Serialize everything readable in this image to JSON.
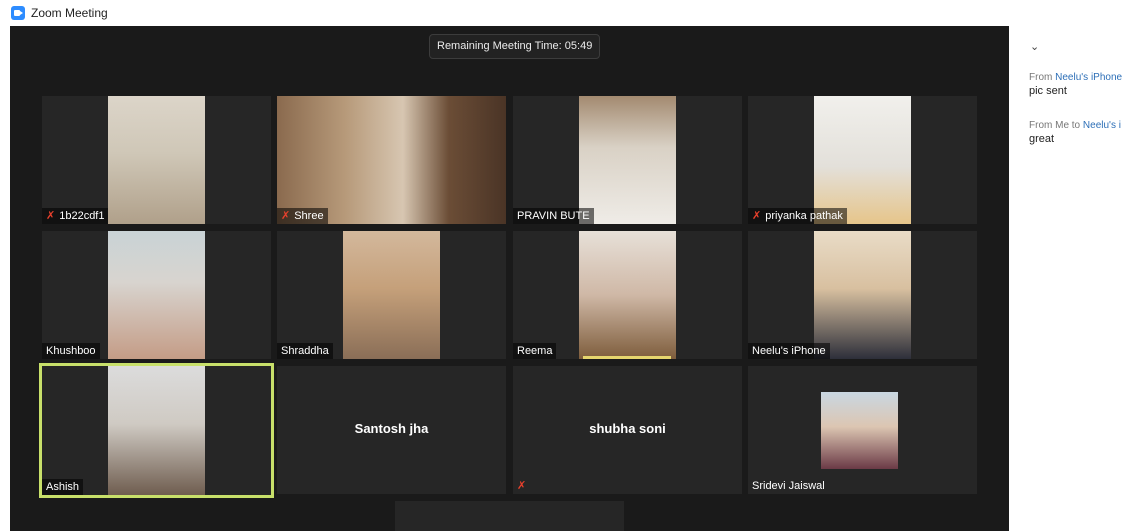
{
  "window": {
    "title": "Zoom Meeting"
  },
  "meeting": {
    "remaining_time": "Remaining Meeting Time: 05:49"
  },
  "participants": [
    {
      "name": "1b22cdf1",
      "muted": true
    },
    {
      "name": "Shree",
      "muted": true
    },
    {
      "name": "PRAVIN BUTE",
      "muted": false
    },
    {
      "name": "priyanka pathak",
      "muted": true
    },
    {
      "name": "Khushboo",
      "muted": false
    },
    {
      "name": "Shraddha",
      "muted": false
    },
    {
      "name": "Reema",
      "muted": false
    },
    {
      "name": "Neelu's iPhone",
      "muted": false
    },
    {
      "name": "Ashish",
      "muted": false,
      "active_speaker": true
    },
    {
      "name": "Santosh jha",
      "video": false
    },
    {
      "name": "shubha soni",
      "video": false,
      "muted": true
    },
    {
      "name": "Sridevi Jaiswal",
      "video": false,
      "profile_picture": true
    }
  ],
  "chat": {
    "messages": [
      {
        "from_label": "From",
        "sender": "Neelu's iPhone",
        "text": "pic sent"
      },
      {
        "from_label": "From Me to",
        "sender": "Neelu's i",
        "text": "great"
      }
    ]
  },
  "colors": {
    "meeting_bg": "#1a1a1a",
    "tile_bg": "#262626",
    "active_border": "#c8e06a",
    "mute_red": "#e8402c",
    "zoom_blue": "#2d8cff"
  },
  "icons": {
    "app": "zoom-logo-icon",
    "mute": "muted-mic-icon",
    "collapse": "chevron-down-icon"
  }
}
